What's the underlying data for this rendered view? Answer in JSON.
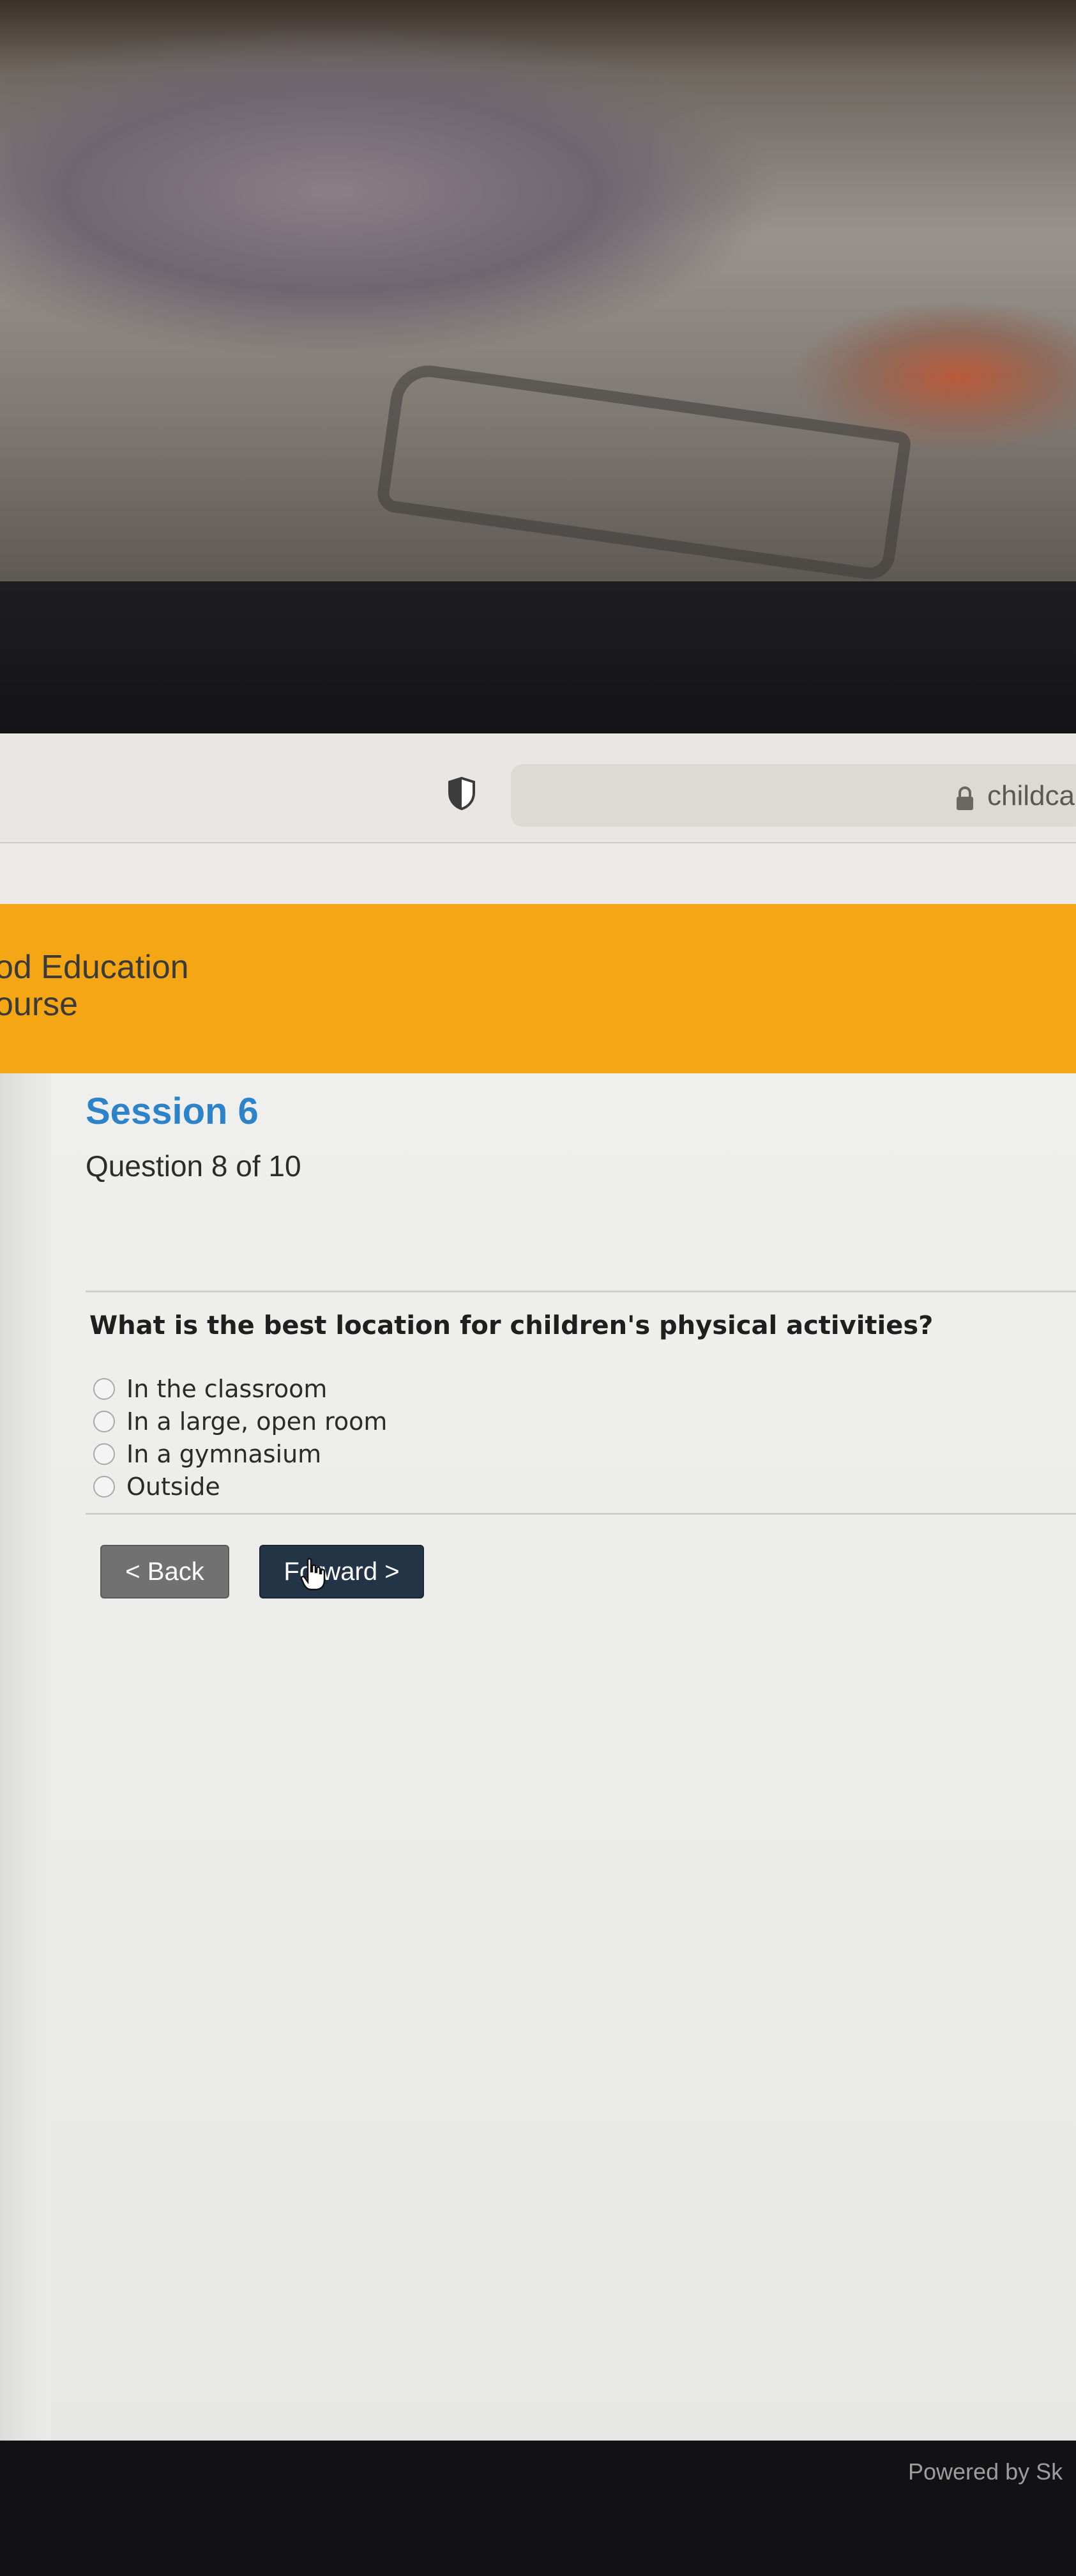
{
  "browser": {
    "url": "childca"
  },
  "site": {
    "title_line1": "od Education",
    "title_line2": "ourse",
    "header_color": "#f5a614"
  },
  "quiz": {
    "session": "Session 6",
    "progress": "Question 8 of 10",
    "question": "What is the best location for children's physical activities?",
    "options": [
      "In the classroom",
      "In a large, open room",
      "In a gymnasium",
      "Outside"
    ],
    "back_label": "< Back",
    "forward_label": "Forward >"
  },
  "footer": {
    "powered_by": "Powered by Sk"
  },
  "icons": {
    "shield": "shield-icon",
    "lock": "lock-icon",
    "cursor": "hand-pointer-icon"
  },
  "colors": {
    "accent": "#2c83c9",
    "forward_button": "#243447",
    "back_button": "#717171"
  }
}
